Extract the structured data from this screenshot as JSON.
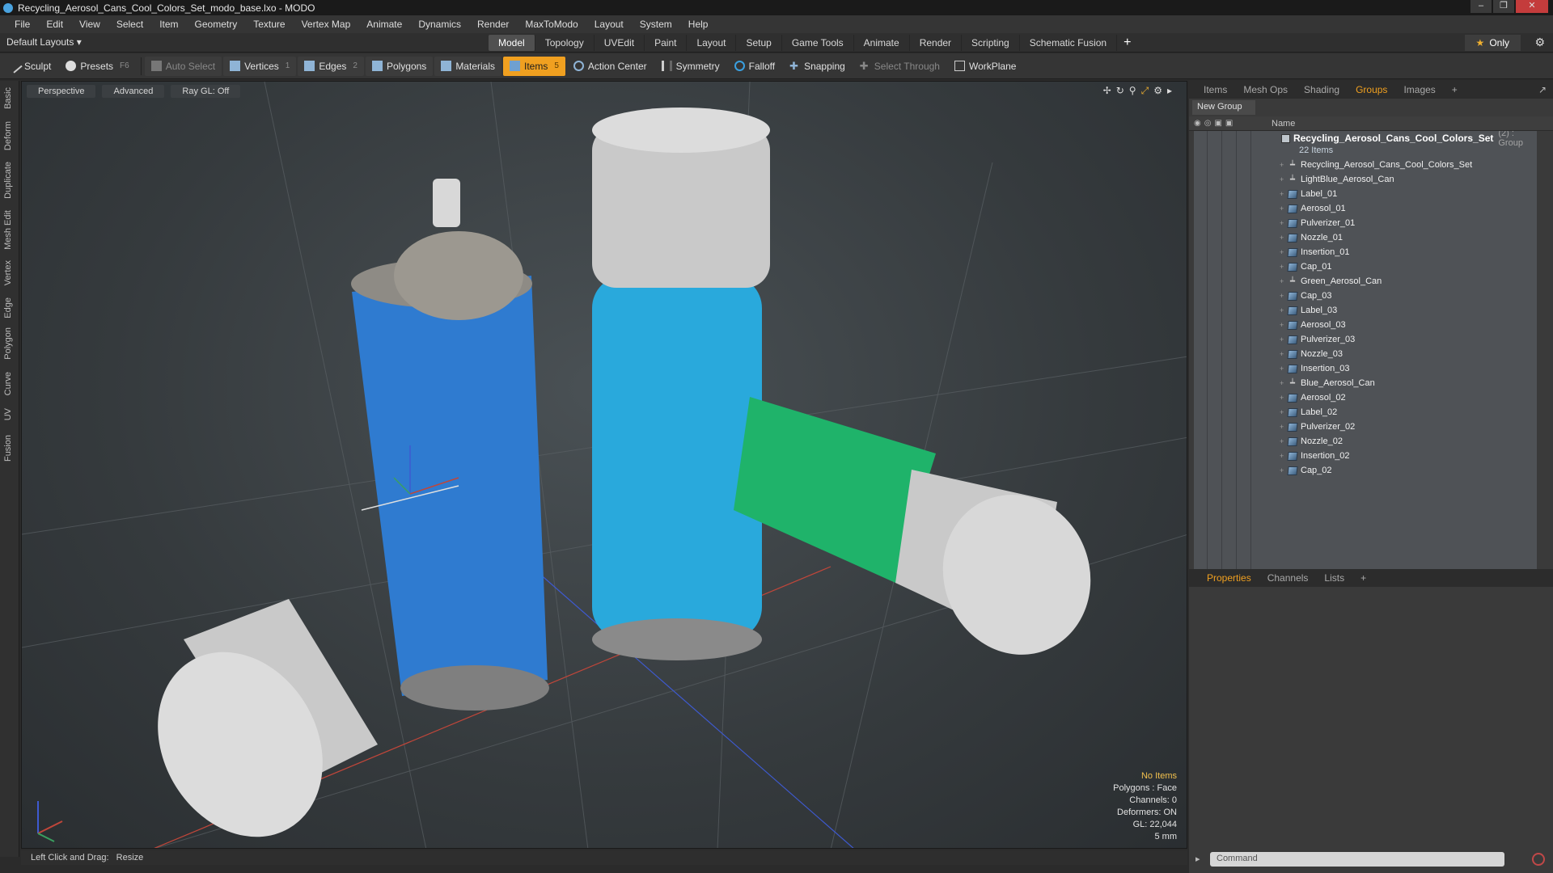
{
  "window": {
    "title": "Recycling_Aerosol_Cans_Cool_Colors_Set_modo_base.lxo - MODO"
  },
  "menu": [
    "File",
    "Edit",
    "View",
    "Select",
    "Item",
    "Geometry",
    "Texture",
    "Vertex Map",
    "Animate",
    "Dynamics",
    "Render",
    "MaxToModo",
    "Layout",
    "System",
    "Help"
  ],
  "layoutbar": {
    "layout_selector": "Default Layouts ▾",
    "tabs": [
      "Model",
      "Topology",
      "UVEdit",
      "Paint",
      "Layout",
      "Setup",
      "Game Tools",
      "Animate",
      "Render",
      "Scripting",
      "Schematic Fusion"
    ],
    "active_tab": "Model",
    "only_label": "Only"
  },
  "toolbar": {
    "sculpt": "Sculpt",
    "presets": "Presets",
    "presets_shortcut": "F6",
    "auto_select": "Auto Select",
    "vertices": "Vertices",
    "vertices_count": "1",
    "edges": "Edges",
    "edges_count": "2",
    "polygons": "Polygons",
    "materials": "Materials",
    "items": "Items",
    "items_count": "5",
    "action_center": "Action Center",
    "symmetry": "Symmetry",
    "falloff": "Falloff",
    "snapping": "Snapping",
    "select_through": "Select Through",
    "workplane": "WorkPlane"
  },
  "left_tabs": [
    "Basic",
    "Deform",
    "Duplicate",
    "Mesh Edit",
    "Vertex",
    "Edge",
    "Polygon",
    "Curve",
    "UV",
    "Fusion"
  ],
  "viewport": {
    "view_mode": "Perspective",
    "shading": "Advanced",
    "raygl": "Ray GL: Off",
    "info": {
      "no_items": "No Items",
      "polygons": "Polygons : Face",
      "channels": "Channels: 0",
      "deformers": "Deformers: ON",
      "gl": "GL: 22,044",
      "unit": "5 mm"
    }
  },
  "statusbar": {
    "label": "Left Click and Drag:",
    "action": "Resize"
  },
  "right_panel": {
    "tabs": [
      "Items",
      "Mesh Ops",
      "Shading",
      "Groups",
      "Images"
    ],
    "active_tab": "Groups",
    "new_group": "New Group",
    "name_header": "Name",
    "group": {
      "name": "Recycling_Aerosol_Cans_Cool_Colors_Set",
      "count": "(2) : Group",
      "subcount": "22 Items"
    },
    "items": [
      {
        "name": "Recycling_Aerosol_Cans_Cool_Colors_Set",
        "kind": "locator"
      },
      {
        "name": "LightBlue_Aerosol_Can",
        "kind": "locator"
      },
      {
        "name": "Label_01",
        "kind": "mesh"
      },
      {
        "name": "Aerosol_01",
        "kind": "mesh"
      },
      {
        "name": "Pulverizer_01",
        "kind": "mesh"
      },
      {
        "name": "Nozzle_01",
        "kind": "mesh"
      },
      {
        "name": "Insertion_01",
        "kind": "mesh"
      },
      {
        "name": "Cap_01",
        "kind": "mesh"
      },
      {
        "name": "Green_Aerosol_Can",
        "kind": "locator"
      },
      {
        "name": "Cap_03",
        "kind": "mesh"
      },
      {
        "name": "Label_03",
        "kind": "mesh"
      },
      {
        "name": "Aerosol_03",
        "kind": "mesh"
      },
      {
        "name": "Pulverizer_03",
        "kind": "mesh"
      },
      {
        "name": "Nozzle_03",
        "kind": "mesh"
      },
      {
        "name": "Insertion_03",
        "kind": "mesh"
      },
      {
        "name": "Blue_Aerosol_Can",
        "kind": "locator"
      },
      {
        "name": "Aerosol_02",
        "kind": "mesh"
      },
      {
        "name": "Label_02",
        "kind": "mesh"
      },
      {
        "name": "Pulverizer_02",
        "kind": "mesh"
      },
      {
        "name": "Nozzle_02",
        "kind": "mesh"
      },
      {
        "name": "Insertion_02",
        "kind": "mesh"
      },
      {
        "name": "Cap_02",
        "kind": "mesh"
      }
    ],
    "props_tabs": [
      "Properties",
      "Channels",
      "Lists"
    ],
    "props_active": "Properties",
    "command_placeholder": "Command"
  },
  "colors": {
    "accent": "#f0a020",
    "blue_can": "#2f7bd0",
    "lightblue_can": "#29a9dc",
    "green_can": "#1fb36a",
    "cap_gray": "#c9c9c9"
  }
}
